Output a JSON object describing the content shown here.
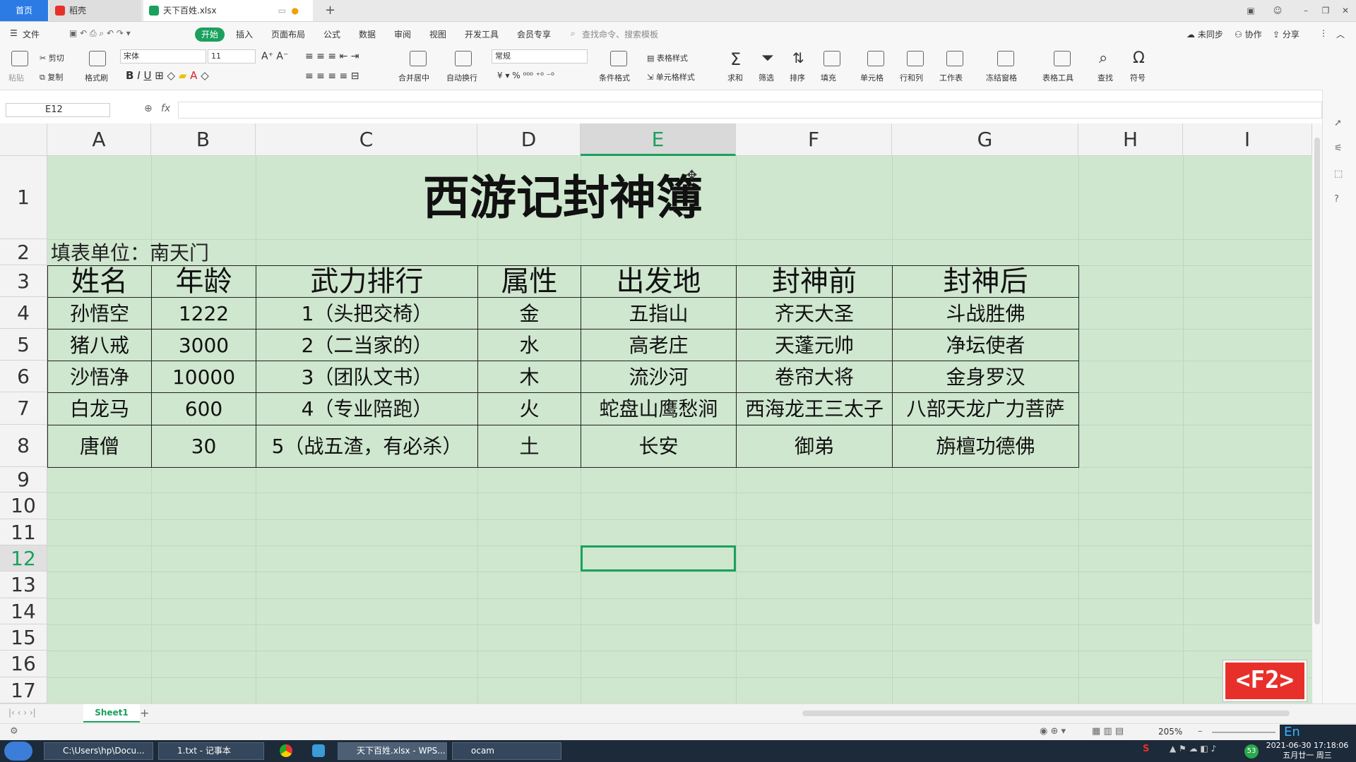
{
  "titlebar": {
    "home_tab": "首页",
    "tab2": "稻壳",
    "tab3": "天下百姓.xlsx"
  },
  "menu": {
    "file": "文件",
    "start": "开始",
    "items": [
      "插入",
      "页面布局",
      "公式",
      "数据",
      "审阅",
      "视图",
      "开发工具",
      "会员专享"
    ],
    "search": "查找命令、搜索模板",
    "sync": "未同步",
    "collab": "协作",
    "share": "分享"
  },
  "ribbon": {
    "cut": "剪切",
    "paste": "粘贴",
    "copy": "复制",
    "format_painter": "格式刷",
    "font": "宋体",
    "size": "11",
    "number_format": "常规",
    "merge": "合并居中",
    "wrap": "自动换行",
    "table_style": "表格样式",
    "cond_format": "条件格式",
    "cell_style": "单元格样式",
    "sum": "求和",
    "filter": "筛选",
    "sort": "排序",
    "fill": "填充",
    "cell": "单元格",
    "rowcol": "行和列",
    "worksheet": "工作表",
    "freeze": "冻结窗格",
    "table_tools": "表格工具",
    "find": "查找",
    "symbol": "符号"
  },
  "formula": {
    "namebox": "E12",
    "fx": "fx",
    "value": ""
  },
  "columns": [
    "A",
    "B",
    "C",
    "D",
    "E",
    "F",
    "G",
    "H",
    "I"
  ],
  "rows": [
    "1",
    "2",
    "3",
    "4",
    "5",
    "6",
    "7",
    "8",
    "9",
    "10",
    "11",
    "12",
    "13",
    "14",
    "15",
    "16",
    "17"
  ],
  "sheet": {
    "title": "西游记封神簿",
    "unit": "填表单位：南天门",
    "headers": [
      "姓名",
      "年龄",
      "武力排行",
      "属性",
      "出发地",
      "封神前",
      "封神后"
    ],
    "data": [
      [
        "孙悟空",
        "1222",
        "1（头把交椅）",
        "金",
        "五指山",
        "齐天大圣",
        "斗战胜佛"
      ],
      [
        "猪八戒",
        "3000",
        "2（二当家的）",
        "水",
        "高老庄",
        "天蓬元帅",
        "净坛使者"
      ],
      [
        "沙悟净",
        "10000",
        "3（团队文书）",
        "木",
        "流沙河",
        "卷帘大将",
        "金身罗汉"
      ],
      [
        "白龙马",
        "600",
        "4（专业陪跑）",
        "火",
        "蛇盘山鹰愁涧",
        "西海龙王三太子",
        "八部天龙广力菩萨"
      ],
      [
        "唐僧",
        "30",
        "5（战五渣，有必杀）",
        "土",
        "长安",
        "御弟",
        "旃檀功德佛"
      ]
    ]
  },
  "sheettab": {
    "name": "Sheet1",
    "add": "+"
  },
  "status": {
    "zoom": "205%"
  },
  "badge": "<F2>",
  "taskbar": {
    "items": [
      "C:\\Users\\hp\\Docu...",
      "1.txt - 记事本",
      "天下百姓.xlsx - WPS...",
      "ocam"
    ],
    "time": "2021-06-30 17:18:06",
    "date": "五月廿一 周三",
    "ime": "En"
  },
  "colors": {
    "accent": "#1aa15d",
    "sheet_bg": "#cfe6cf",
    "badge": "#e8302a"
  }
}
